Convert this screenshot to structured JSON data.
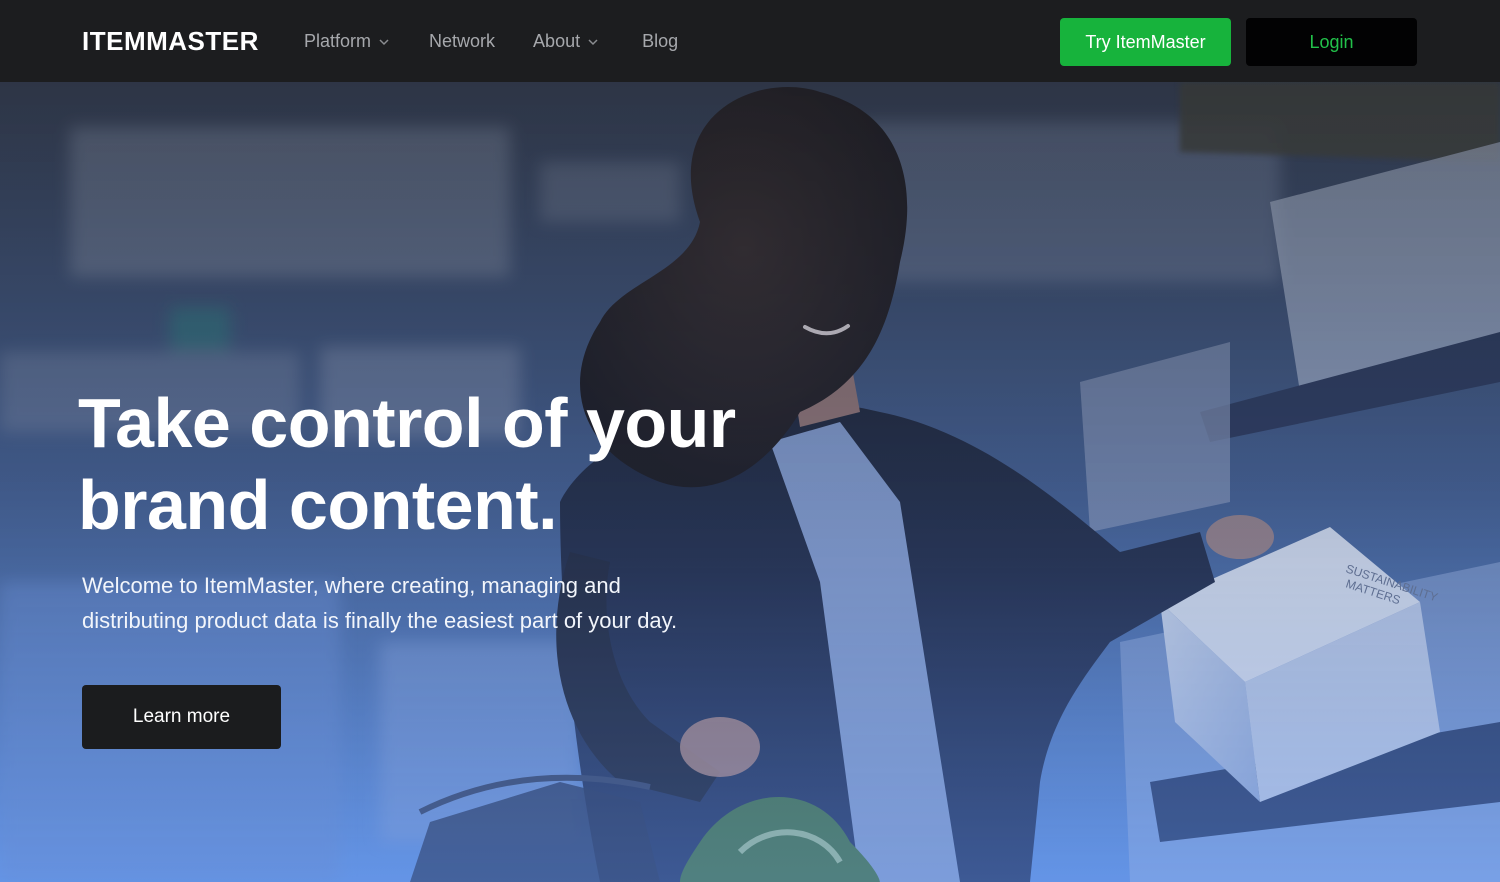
{
  "nav": {
    "brand": "ITEMMASTER",
    "links": [
      {
        "label": "Platform",
        "has_dropdown": true
      },
      {
        "label": "Network",
        "has_dropdown": false
      },
      {
        "label": "About",
        "has_dropdown": true
      },
      {
        "label": "Blog",
        "has_dropdown": false
      }
    ],
    "try_button": "Try ItemMaster",
    "login_button": "Login"
  },
  "hero": {
    "headline_line1": "Take control of your",
    "headline_line2": "brand content.",
    "subtext_line1": "Welcome to ItemMaster, where creating, managing and",
    "subtext_line2": "distributing product data is finally the easiest part of your day.",
    "cta": "Learn more",
    "photo_icon": "woman-shopping-photo"
  },
  "colors": {
    "nav_bg": "#1c1d1f",
    "accent_green": "#17b33c",
    "login_text_green": "#22c14a",
    "hero_blue": "#5e8fe0"
  }
}
